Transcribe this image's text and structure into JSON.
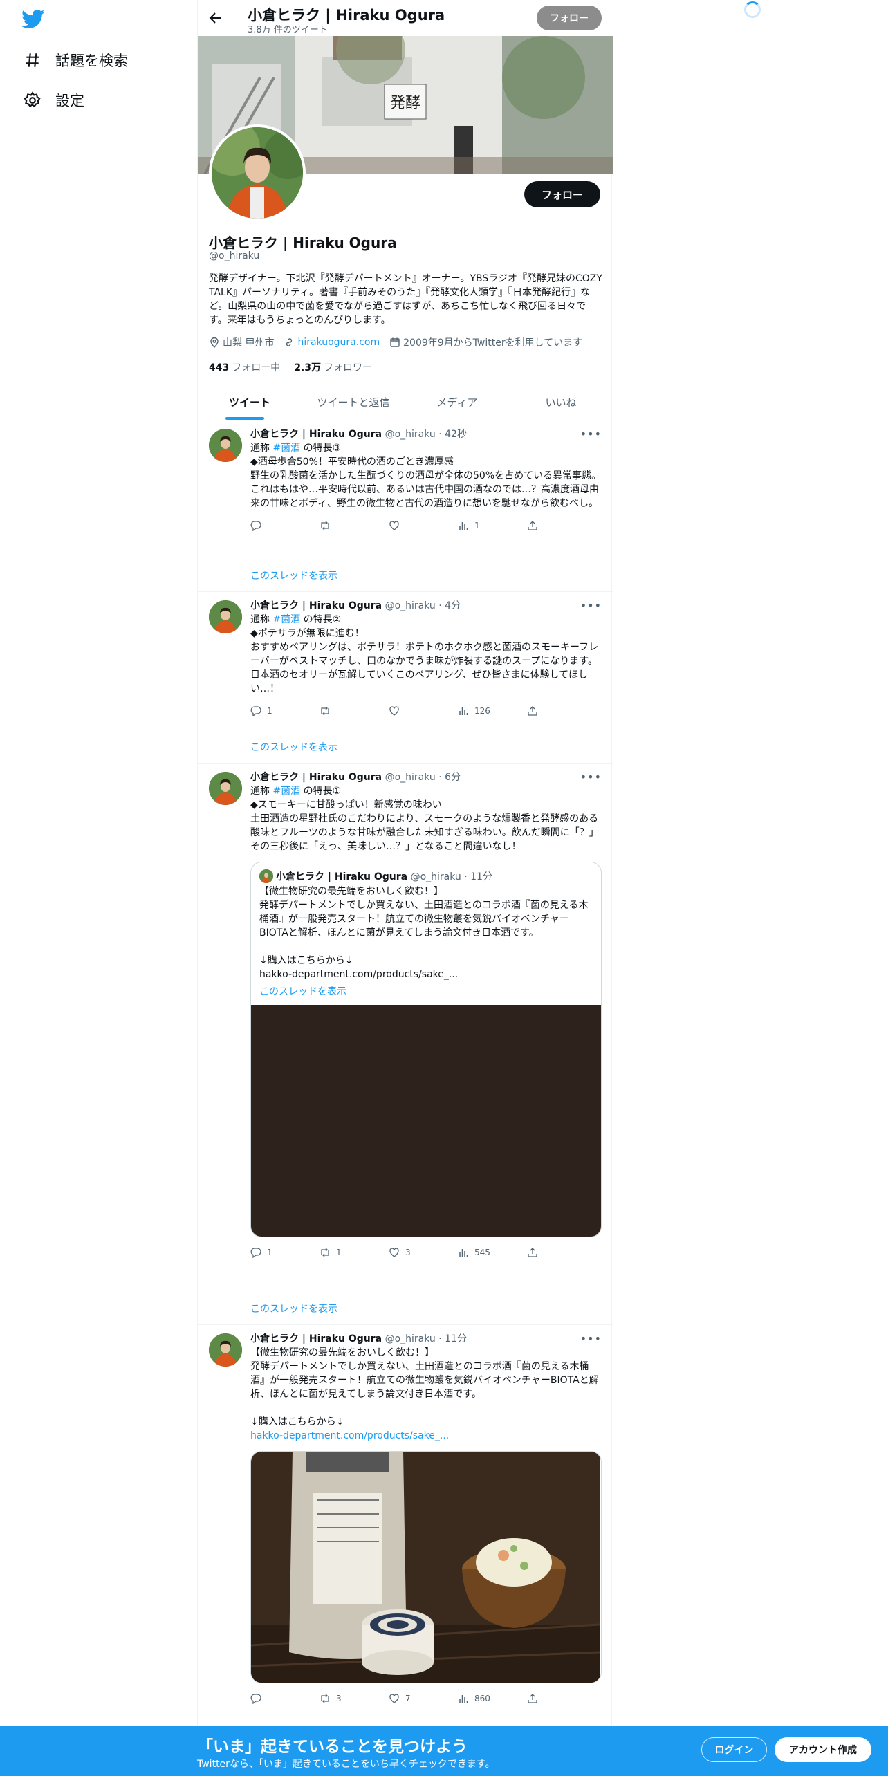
{
  "sidebar": {
    "items": [
      {
        "label": "話題を検索",
        "icon": "hashtag-icon"
      },
      {
        "label": "設定",
        "icon": "gear-icon"
      }
    ]
  },
  "header": {
    "name": "小倉ヒラク | Hiraku Ogura",
    "tweet_count": "3.8万 件のツイート",
    "follow_label": "フォロー"
  },
  "profile": {
    "follow_label": "フォロー",
    "name": "小倉ヒラク | Hiraku Ogura",
    "handle": "@o_hiraku",
    "bio": "発酵デザイナー。下北沢『発酵デパートメント』オーナー。YBSラジオ『発酵兄妹のCOZY TALK』パーソナリティ。著書『手前みそのうた』『発酵文化人類学』『日本発酵紀行』など。山梨県の山の中で菌を愛でながら過ごすはずが、あちこち忙しなく飛び回る日々です。来年はもうちょっとのんびりします。",
    "location": "山梨 甲州市",
    "url": "hirakuogura.com",
    "joined": "2009年9月からTwitterを利用しています",
    "following_count": "443",
    "following_label": "フォロー中",
    "followers_count": "2.3万",
    "followers_label": "フォロワー",
    "banner_sign": "発酵"
  },
  "tabs": [
    "ツイート",
    "ツイートと返信",
    "メディア",
    "いいね"
  ],
  "tweets": [
    {
      "name": "小倉ヒラク | Hiraku Ogura",
      "meta": "@o_hiraku · 42秒",
      "line1_pre": "通称 ",
      "hashtag": "#菌酒",
      "line1_post": " の特長③",
      "text": "◆酒母歩合50%！平安時代の酒のごとき濃厚感\n野生の乳酸菌を活かした生酛づくりの酒母が全体の50%を占めている異常事態。これはもはや…平安時代以前、あるいは古代中国の酒なのでは…？高濃度酒母由来の甘味とボディ、野生の微生物と古代の酒造りに想いを馳せながら飲むべし。",
      "replies": "",
      "retweets": "",
      "likes": "",
      "views": "1",
      "thread_link": "このスレッドを表示"
    },
    {
      "name": "小倉ヒラク | Hiraku Ogura",
      "meta": "@o_hiraku · 4分",
      "line1_pre": "通称 ",
      "hashtag": "#菌酒",
      "line1_post": " の特長②",
      "text": "◆ポテサラが無限に進む！\nおすすめペアリングは、ポテサラ！ポテトのホクホク感と菌酒のスモーキーフレーバーがベストマッチし、口のなかでうま味が炸裂する謎のスープになります。日本酒のセオリーが瓦解していくこのペアリング、ぜひ皆さまに体験してほしい…！",
      "replies": "1",
      "retweets": "",
      "likes": "",
      "views": "126",
      "thread_link": "このスレッドを表示"
    },
    {
      "name": "小倉ヒラク | Hiraku Ogura",
      "meta": "@o_hiraku · 6分",
      "line1_pre": "通称 ",
      "hashtag": "#菌酒",
      "line1_post": " の特長①",
      "text": "◆スモーキーに甘酸っぱい！新感覚の味わい\n土田酒造の星野杜氏のこだわりにより、スモークのような燻製香と発酵感のある酸味とフルーツのような甘味が融合した未知すぎる味わい。飲んだ瞬間に「？」その三秒後に「えっ、美味しい…？」となること間違いなし！",
      "quote": {
        "name": "小倉ヒラク | Hiraku Ogura",
        "meta": "@o_hiraku · 11分",
        "text": "【微生物研究の最先端をおいしく飲む！】\n発酵デパートメントでしか買えない、土田酒造とのコラボ酒『菌の見える木桶酒』が一般発売スタート！航立ての微生物叢を気鋭バイオベンチャーBIOTAと解析、ほんとに菌が見えてしまう論文付き日本酒です。\n\n↓購入はこちらから↓\nhakko-department.com/products/sake_...",
        "thread_link": "このスレッドを表示"
      },
      "replies": "1",
      "retweets": "1",
      "likes": "3",
      "views": "545",
      "thread_link": "このスレッドを表示"
    },
    {
      "name": "小倉ヒラク | Hiraku Ogura",
      "meta": "@o_hiraku · 11分",
      "text": "【微生物研究の最先端をおいしく飲む！】\n発酵デパートメントでしか買えない、土田酒造とのコラボ酒『菌の見える木桶酒』が一般発売スタート！航立ての微生物叢を気鋭バイオベンチャーBIOTAと解析、ほんとに菌が見えてしまう論文付き日本酒です。\n\n↓購入はこちらから↓",
      "link": "hakko-department.com/products/sake_...",
      "replies": "",
      "retweets": "3",
      "likes": "7",
      "views": "860"
    }
  ],
  "bottom_bar": {
    "title": "「いま」起きていることを見つけよう",
    "subtitle": "Twitterなら、「いま」起きていることをいち早くチェックできます。",
    "login_label": "ログイン",
    "signup_label": "アカウント作成"
  },
  "colors": {
    "accent": "#1d9bf0",
    "text": "#0f1419",
    "secondary": "#536471"
  }
}
